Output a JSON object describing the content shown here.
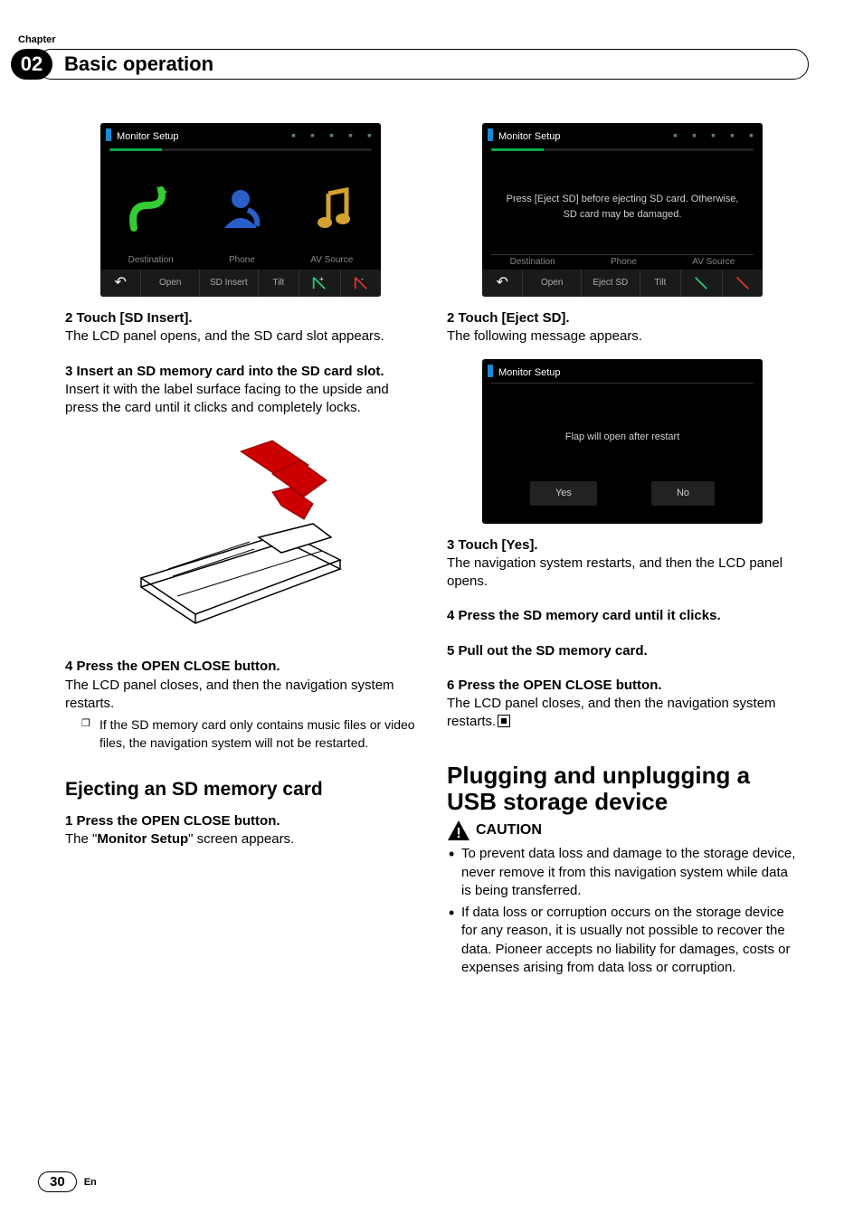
{
  "header": {
    "chapter_label": "Chapter",
    "chapter_number": "02",
    "title": "Basic operation"
  },
  "screenshot1": {
    "title": "Monitor Setup",
    "labels": {
      "l1": "Destination",
      "l2": "Phone",
      "l3": "AV Source"
    },
    "buttons": {
      "b1": "Open",
      "b2": "SD Insert",
      "b3": "Tilt"
    }
  },
  "left": {
    "s2_head": "2    Touch [SD Insert].",
    "s2_body": "The LCD panel opens, and the SD card slot appears.",
    "s3_head": "3    Insert an SD memory card into the SD card slot.",
    "s3_body": "Insert it with the label surface facing to the upside and press the card until it clicks and completely locks.",
    "s4_head": "4    Press the OPEN CLOSE button.",
    "s4_body": "The LCD panel closes, and then the navigation system restarts.",
    "note": "If the SD memory card only contains music files or video files, the navigation system will not be restarted.",
    "h2": "Ejecting an SD memory card",
    "e1_head": "1    Press the OPEN CLOSE button.",
    "e1_body_a": "The \"",
    "e1_body_bold": "Monitor Setup",
    "e1_body_b": "\" screen appears."
  },
  "screenshot2": {
    "title": "Monitor Setup",
    "message_l1": "Press [Eject SD] before ejecting SD card. Otherwise,",
    "message_l2": "SD card may be damaged.",
    "labels": {
      "l1": "Destination",
      "l2": "Phone",
      "l3": "AV Source"
    },
    "buttons": {
      "b1": "Open",
      "b2": "Eject SD",
      "b3": "Tilt"
    }
  },
  "right": {
    "s2_head": "2    Touch [Eject SD].",
    "s2_body": "The following message appears."
  },
  "screenshot3": {
    "title": "Monitor Setup",
    "message": "Flap will open after restart",
    "yes": "Yes",
    "no": "No"
  },
  "right2": {
    "s3_head": "3    Touch [Yes].",
    "s3_body": "The navigation system restarts, and then the LCD panel opens.",
    "s4_head": "4    Press the SD memory card until it clicks.",
    "s5_head": "5    Pull out the SD memory card.",
    "s6_head": "6    Press the OPEN CLOSE button.",
    "s6_body": "The LCD panel closes, and then the navigation system restarts.",
    "h1": "Plugging and unplugging a USB storage device",
    "caution": "CAUTION",
    "bullet1": "To prevent data loss and damage to the storage device, never remove it from this navigation system while data is being transferred.",
    "bullet2": "If data loss or corruption occurs on the storage device for any reason, it is usually not possible to recover the data. Pioneer accepts no liability for damages, costs or expenses arising from data loss or corruption."
  },
  "footer": {
    "page": "30",
    "lang": "En"
  }
}
